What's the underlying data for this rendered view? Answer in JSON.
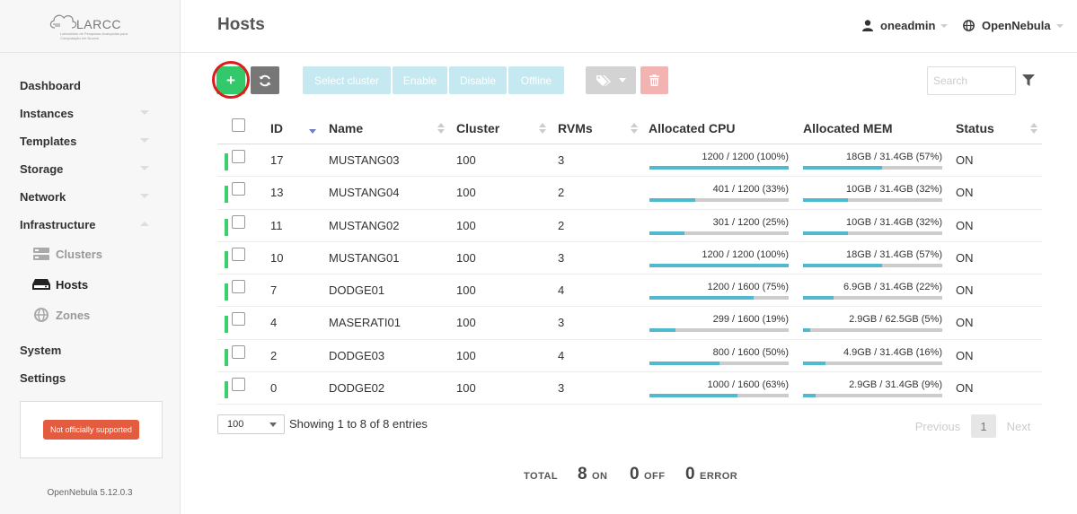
{
  "sidebar": {
    "logo_text": "LARCC",
    "logo_subtitle": "Laboratório de Pesquisas Avançadas para Computação em Nuvem",
    "menu": {
      "dashboard": "Dashboard",
      "instances": "Instances",
      "templates": "Templates",
      "storage": "Storage",
      "network": "Network",
      "infrastructure": "Infrastructure",
      "clusters": "Clusters",
      "hosts": "Hosts",
      "zones": "Zones",
      "system": "System",
      "settings": "Settings"
    },
    "support_badge": "Not officially supported",
    "version": "OpenNebula 5.12.0.3"
  },
  "header": {
    "title": "Hosts",
    "user": "oneadmin",
    "zone": "OpenNebula"
  },
  "toolbar": {
    "create_label": "+",
    "select_cluster": "Select cluster",
    "enable": "Enable",
    "disable": "Disable",
    "offline": "Offline",
    "search_placeholder": "Search"
  },
  "table": {
    "columns": {
      "id": "ID",
      "name": "Name",
      "cluster": "Cluster",
      "rvms": "RVMs",
      "cpu": "Allocated CPU",
      "mem": "Allocated MEM",
      "status": "Status"
    },
    "rows": [
      {
        "id": "17",
        "name": "MUSTANG03",
        "cluster": "100",
        "rvms": "3",
        "cpu": "1200 / 1200 (100%)",
        "cpu_pct": 100,
        "mem": "18GB / 31.4GB (57%)",
        "mem_pct": 57,
        "status": "ON"
      },
      {
        "id": "13",
        "name": "MUSTANG04",
        "cluster": "100",
        "rvms": "2",
        "cpu": "401 / 1200 (33%)",
        "cpu_pct": 33,
        "mem": "10GB / 31.4GB (32%)",
        "mem_pct": 32,
        "status": "ON"
      },
      {
        "id": "11",
        "name": "MUSTANG02",
        "cluster": "100",
        "rvms": "2",
        "cpu": "301 / 1200 (25%)",
        "cpu_pct": 25,
        "mem": "10GB / 31.4GB (32%)",
        "mem_pct": 32,
        "status": "ON"
      },
      {
        "id": "10",
        "name": "MUSTANG01",
        "cluster": "100",
        "rvms": "3",
        "cpu": "1200 / 1200 (100%)",
        "cpu_pct": 100,
        "mem": "18GB / 31.4GB (57%)",
        "mem_pct": 57,
        "status": "ON"
      },
      {
        "id": "7",
        "name": "DODGE01",
        "cluster": "100",
        "rvms": "4",
        "cpu": "1200 / 1600 (75%)",
        "cpu_pct": 75,
        "mem": "6.9GB / 31.4GB (22%)",
        "mem_pct": 22,
        "status": "ON"
      },
      {
        "id": "4",
        "name": "MASERATI01",
        "cluster": "100",
        "rvms": "3",
        "cpu": "299 / 1600 (19%)",
        "cpu_pct": 19,
        "mem": "2.9GB / 62.5GB (5%)",
        "mem_pct": 5,
        "status": "ON"
      },
      {
        "id": "2",
        "name": "DODGE03",
        "cluster": "100",
        "rvms": "4",
        "cpu": "800 / 1600 (50%)",
        "cpu_pct": 50,
        "mem": "4.9GB / 31.4GB (16%)",
        "mem_pct": 16,
        "status": "ON"
      },
      {
        "id": "0",
        "name": "DODGE02",
        "cluster": "100",
        "rvms": "3",
        "cpu": "1000 / 1600 (63%)",
        "cpu_pct": 63,
        "mem": "2.9GB / 31.4GB (9%)",
        "mem_pct": 9,
        "status": "ON"
      }
    ]
  },
  "footer": {
    "page_length": "100",
    "entries_info": "Showing 1 to 8 of 8 entries",
    "previous": "Previous",
    "current_page": "1",
    "next": "Next"
  },
  "totals": {
    "total_label": "TOTAL",
    "on_count": "8",
    "on_label": "ON",
    "off_count": "0",
    "off_label": "OFF",
    "error_count": "0",
    "error_label": "ERROR"
  },
  "colors": {
    "create_button": "#33c96b",
    "highlight_ring": "#e01b1b",
    "state_on": "#3bcf6d",
    "bar_fill": "#4fb9cf",
    "badge": "#e45c3f"
  }
}
